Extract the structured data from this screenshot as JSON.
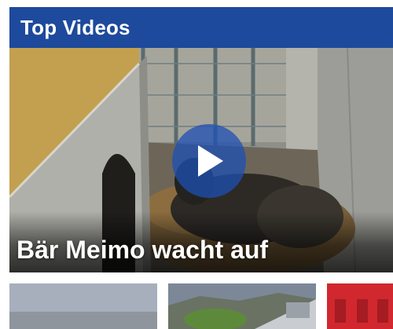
{
  "widget": {
    "title": "Top Videos",
    "featured": {
      "caption": "Bär Meimo wacht auf",
      "play_icon": "play-icon"
    },
    "thumbnails": [
      {
        "name": "video-thumbnail-1"
      },
      {
        "name": "video-thumbnail-2"
      },
      {
        "name": "video-thumbnail-3"
      }
    ]
  },
  "colors": {
    "header_bg": "#1d4a9c",
    "play_button": "#1e50b4",
    "caption_text": "#ffffff"
  }
}
